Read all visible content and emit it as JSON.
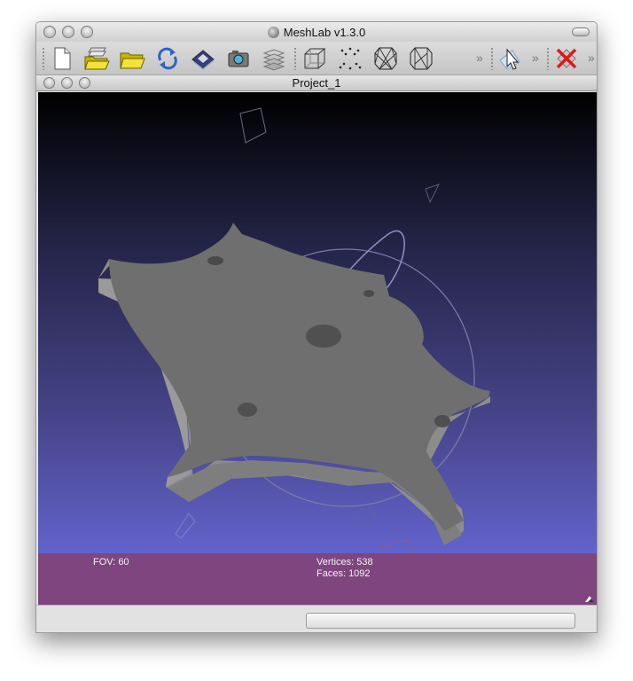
{
  "window": {
    "title": "MeshLab v1.3.0"
  },
  "document": {
    "title": "Project_1"
  },
  "toolbar": {
    "buttons": [
      {
        "name": "new-project-button",
        "icon": "new-document-icon"
      },
      {
        "name": "open-project-button",
        "icon": "open-layers-folder-icon"
      },
      {
        "name": "open-mesh-button",
        "icon": "open-folder-icon"
      },
      {
        "name": "reload-button",
        "icon": "reload-icon"
      },
      {
        "name": "save-button",
        "icon": "save-disk-icon"
      },
      {
        "name": "snapshot-button",
        "icon": "camera-icon"
      },
      {
        "name": "layers-button",
        "icon": "layers-icon"
      },
      {
        "name": "render-bbox-button",
        "icon": "bounding-box-icon"
      },
      {
        "name": "render-points-button",
        "icon": "points-icon"
      },
      {
        "name": "render-wireframe-button",
        "icon": "wireframe-icon"
      },
      {
        "name": "render-hidden-lines-button",
        "icon": "hidden-lines-icon"
      },
      {
        "name": "select-tool-button",
        "icon": "pointer-select-icon"
      },
      {
        "name": "delete-faces-button",
        "icon": "delete-red-x-icon"
      }
    ],
    "more_glyph": "»"
  },
  "viewport": {
    "fov_label": "FOV: 60",
    "vertices_label": "Vertices: 538",
    "faces_label": "Faces: 1092"
  },
  "colors": {
    "background_top": "#000000",
    "background_bottom": "#6d6ee6",
    "info_bar": "#7e457e",
    "mesh_top": "#6f6f6f",
    "mesh_side": "#8a8a8a"
  },
  "status": {
    "progress": 0
  }
}
